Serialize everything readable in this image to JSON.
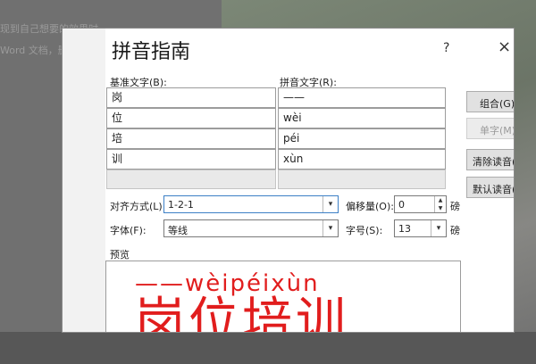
{
  "background": {
    "line1": "现到自己想要的效果时，",
    "line2": "Word 文档，删"
  },
  "dialog": {
    "title": "拼音指南",
    "help": "?",
    "close": "×",
    "base_header": "基准文字(B):",
    "ruby_header": "拼音文字(R):",
    "rows": [
      {
        "base": "岗",
        "ruby": "——"
      },
      {
        "base": "位",
        "ruby": "wèi"
      },
      {
        "base": "培",
        "ruby": "péi"
      },
      {
        "base": "训",
        "ruby": "xùn"
      },
      {
        "base": "",
        "ruby": ""
      }
    ],
    "buttons": {
      "group": "组合(G)",
      "mono": "单字(M)",
      "clear": "清除读音(",
      "default": "默认读音("
    },
    "alignment": {
      "label": "对齐方式(L):",
      "value": "1-2-1"
    },
    "offset": {
      "label": "偏移量(O):",
      "value": "0",
      "unit": "磅"
    },
    "font": {
      "label": "字体(F):",
      "value": "等线"
    },
    "size": {
      "label": "字号(S):",
      "value": "13",
      "unit": "磅"
    },
    "preview": {
      "label": "预览",
      "pinyin": "——wèipéixùn",
      "base": "岗位培训"
    },
    "colors": {
      "preview_text": "#e11d1d"
    }
  }
}
